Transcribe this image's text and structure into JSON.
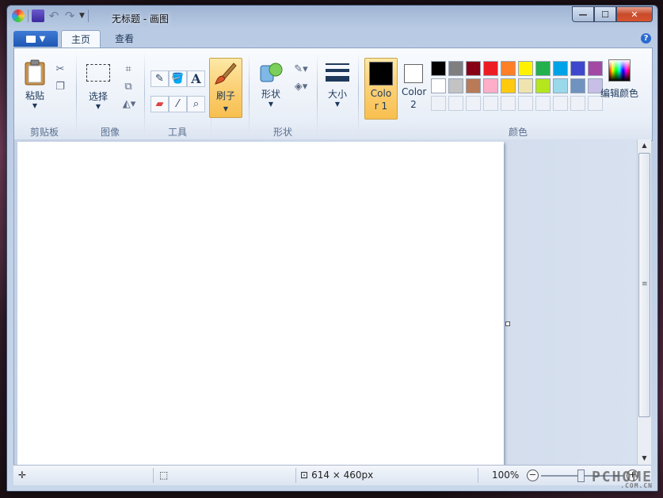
{
  "window": {
    "title": "无标题 - 画图",
    "controls": {
      "minimize": "—",
      "maximize": "☐",
      "close": "✕"
    }
  },
  "menu": {
    "file_icon": "file-menu-icon"
  },
  "tabs": [
    {
      "label": "主页",
      "active": true
    },
    {
      "label": "查看",
      "active": false
    }
  ],
  "help": "?",
  "ribbon": {
    "clipboard": {
      "label": "剪贴板",
      "paste": "粘贴"
    },
    "image": {
      "label": "图像",
      "select": "选择"
    },
    "tools": {
      "label": "工具",
      "text_tool": "A"
    },
    "brushes": {
      "label": "刷子"
    },
    "shapes": {
      "label": "形状",
      "shapes_btn": "形状"
    },
    "size": {
      "label": "大小"
    },
    "colors": {
      "label": "颜色",
      "color1": "Color 1",
      "color1_value": "#000000",
      "color2": "Color 2",
      "color2_value": "#ffffff",
      "edit": "编辑颜色",
      "palette_row1": [
        "#000000",
        "#7f7f7f",
        "#880015",
        "#ed1c24",
        "#ff7f27",
        "#fff200",
        "#22b14c",
        "#00a2e8",
        "#3f48cc",
        "#a349a4"
      ],
      "palette_row2": [
        "#ffffff",
        "#c3c3c3",
        "#b97a57",
        "#ffaec9",
        "#ffc90e",
        "#efe4b0",
        "#b5e61d",
        "#99d9ea",
        "#7092be",
        "#c8bfe7"
      ]
    }
  },
  "status": {
    "canvas_size": "614 × 460px",
    "zoom": "100%"
  },
  "watermark": {
    "main": "PCHOME",
    "sub": ".COM.CN"
  }
}
